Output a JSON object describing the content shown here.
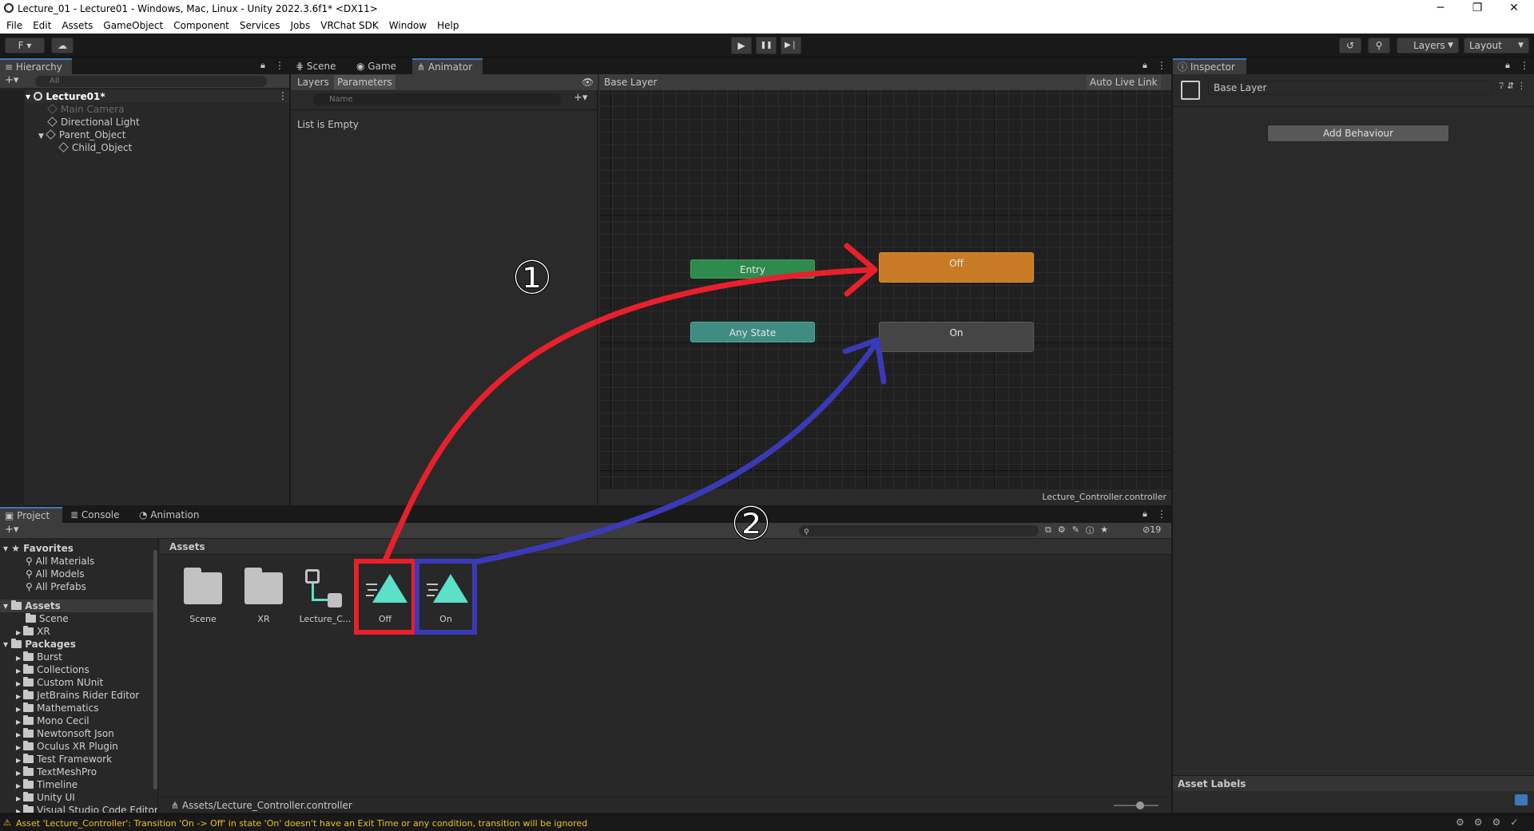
{
  "window": {
    "title": "Lecture_01 - Lecture01 - Windows, Mac, Linux - Unity 2022.3.6f1* <DX11>",
    "min": "─",
    "max": "❐",
    "close": "✕"
  },
  "menu": [
    "File",
    "Edit",
    "Assets",
    "GameObject",
    "Component",
    "Services",
    "Jobs",
    "VRChat SDK",
    "Window",
    "Help"
  ],
  "toolbar": {
    "account": "F ▾",
    "cloud": "☁",
    "play": "▶",
    "pause": "❚❚",
    "step": "▶❘",
    "history": "↺",
    "search": "⚲",
    "layers": "Layers",
    "layout": "Layout"
  },
  "hierarchy": {
    "tab": "Hierarchy",
    "search_placeholder": "All",
    "scene": "Lecture01*",
    "items": [
      "Main Camera",
      "Directional Light",
      "Parent_Object",
      "Child_Object"
    ]
  },
  "center_tabs": [
    "Scene",
    "Game",
    "Animator"
  ],
  "animator": {
    "left_tabs": [
      "Layers",
      "Parameters"
    ],
    "search_placeholder": "Name",
    "list_empty": "List is Empty",
    "breadcrumb": "Base Layer",
    "live_link": "Auto Live Link",
    "footer": "Lecture_Controller.controller",
    "nodes": {
      "entry": "Entry",
      "any_state": "Any State",
      "off": "Off",
      "on": "On"
    }
  },
  "annotations": {
    "one": "①",
    "two": "②",
    "colors": {
      "red": "#e8202c",
      "blue": "#3a3ab8"
    }
  },
  "inspector": {
    "tab": "Inspector",
    "name": "Base Layer",
    "add_behaviour": "Add Behaviour",
    "asset_labels": "Asset Labels"
  },
  "project": {
    "tabs": [
      "Project",
      "Console",
      "Animation"
    ],
    "breadcrumb": "Assets",
    "count": "19",
    "favorites": {
      "label": "Favorites",
      "items": [
        "All Materials",
        "All Models",
        "All Prefabs"
      ]
    },
    "assets_root": "Assets",
    "asset_folders": [
      "Scene",
      "XR"
    ],
    "packages_root": "Packages",
    "packages": [
      "Burst",
      "Collections",
      "Custom NUnit",
      "JetBrains Rider Editor",
      "Mathematics",
      "Mono Cecil",
      "Newtonsoft Json",
      "Oculus XR Plugin",
      "Test Framework",
      "TextMeshPro",
      "Timeline",
      "Unity UI",
      "Visual Studio Code Editor"
    ],
    "assets": [
      "Scene",
      "XR",
      "Lecture_C...",
      "Off",
      "On"
    ],
    "path": "Assets/Lecture_Controller.controller"
  },
  "status": {
    "message": "Asset 'Lecture_Controller': Transition 'On -> Off' in state 'On' doesn't have an Exit Time or any condition, transition will be ignored",
    "warn_color": "#f0c020"
  }
}
